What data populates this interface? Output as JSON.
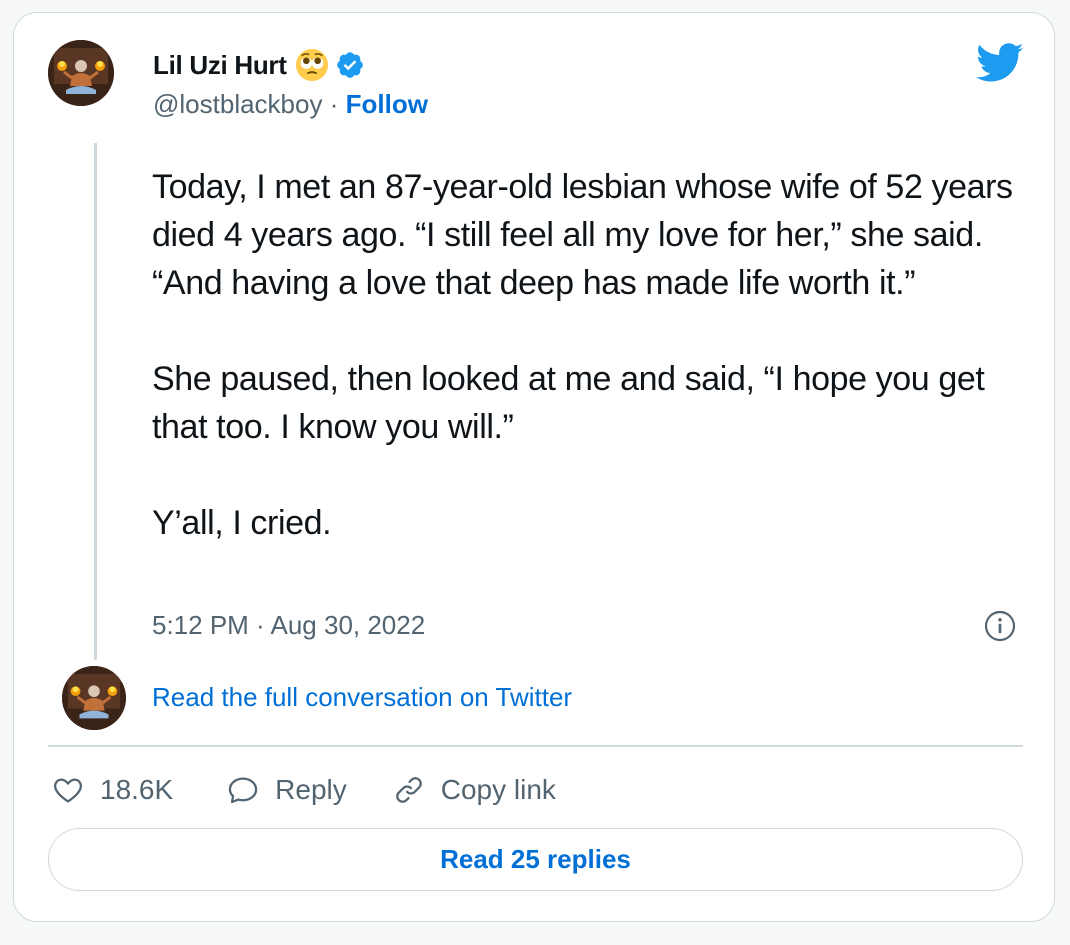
{
  "author": {
    "name": "Lil Uzi Hurt",
    "name_emoji": "pleading-face-emoji",
    "verified": true,
    "handle": "@lostblackboy",
    "separator": "·",
    "follow_label": "Follow"
  },
  "tweet": {
    "paragraphs": [
      "Today, I met an 87-year-old lesbian whose wife of 52 years died 4 years ago. “I still feel all my love for her,” she said. “And having a love that deep has made life worth it.”",
      "She paused, then looked at me and said, “I hope you get that too. I know you will.”",
      "Y’all, I cried."
    ],
    "timestamp": "5:12 PM · Aug 30, 2022"
  },
  "conversation_link": "Read the full conversation on Twitter",
  "actions": {
    "like_count": "18.6K",
    "reply_label": "Reply",
    "copy_link_label": "Copy link"
  },
  "read_replies_label": "Read 25 replies",
  "icons": {
    "brand": "twitter-bird-icon",
    "verified": "verified-badge-icon",
    "info": "info-icon",
    "like": "heart-icon",
    "reply": "speech-bubble-icon",
    "copy": "link-icon"
  },
  "colors": {
    "brand_blue": "#1d9bf0",
    "link_blue": "#006fd6",
    "text": "#0f1419",
    "secondary_text": "#536471",
    "border": "#cfd9de"
  }
}
